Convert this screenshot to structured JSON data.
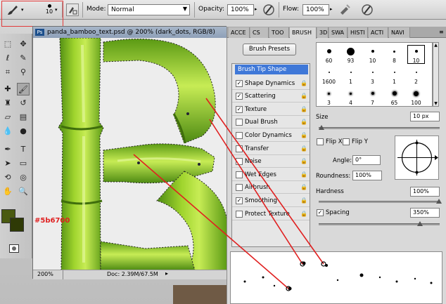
{
  "options_bar": {
    "brush_size": "10",
    "mode_label": "Mode:",
    "mode_value": "Normal",
    "opacity_label": "Opacity:",
    "opacity_value": "100%",
    "flow_label": "Flow:",
    "flow_value": "100%"
  },
  "document": {
    "title": "panda_bamboo_text.psd @ 200% (dark_dots, RGB/8)",
    "badge": "Ps",
    "zoom": "200%",
    "doc_size": "Doc: 2.39M/67.5M",
    "annotation_color_text": "#5b6700",
    "annotation_color": "#e02020",
    "foreground_color": "#4a5a10",
    "background_color": "#2f3a06"
  },
  "panel": {
    "tabs": [
      "ACCE",
      "CS",
      "TOO",
      "BRUSH",
      "3D",
      "SWA",
      "HISTI",
      "ACTI",
      "NAVI"
    ],
    "active_tab": "BRUSH",
    "brush_presets_label": "Brush Presets",
    "options": [
      {
        "label": "Brush Tip Shape",
        "checked": null,
        "header": true
      },
      {
        "label": "Shape Dynamics",
        "checked": true
      },
      {
        "label": "Scattering",
        "checked": true
      },
      {
        "label": "Texture",
        "checked": true
      },
      {
        "label": "Dual Brush",
        "checked": false
      },
      {
        "label": "Color Dynamics",
        "checked": false
      },
      {
        "label": "Transfer",
        "checked": false
      },
      {
        "label": "Noise",
        "checked": false
      },
      {
        "label": "Wet Edges",
        "checked": false
      },
      {
        "label": "Airbrush",
        "checked": false
      },
      {
        "label": "Smoothing",
        "checked": true
      },
      {
        "label": "Protect Texture",
        "checked": false
      }
    ],
    "tips": [
      {
        "size": "60",
        "dot": 6
      },
      {
        "size": "93",
        "dot": 11
      },
      {
        "size": "10",
        "dot": 4
      },
      {
        "size": "8",
        "dot": 3
      },
      {
        "size": "10",
        "dot": 4,
        "selected": true
      },
      {
        "size": "1600",
        "dot": 2
      },
      {
        "size": "1",
        "dot": 2
      },
      {
        "size": "3",
        "dot": 2
      },
      {
        "size": "1",
        "dot": 2
      },
      {
        "size": "2",
        "dot": 2
      },
      {
        "size": "3",
        "dot": 3
      },
      {
        "size": "4",
        "dot": 3
      },
      {
        "size": "7",
        "dot": 4
      },
      {
        "size": "65",
        "dot": 6
      },
      {
        "size": "100",
        "dot": 7
      }
    ],
    "size_label": "Size",
    "size_value": "10 px",
    "flip_x": "Flip X",
    "flip_y": "Flip Y",
    "angle_label": "Angle:",
    "angle_value": "0°",
    "roundness_label": "Roundness:",
    "roundness_value": "100%",
    "hardness_label": "Hardness",
    "hardness_value": "100%",
    "spacing_label": "Spacing",
    "spacing_value": "350%",
    "spacing_checked": true
  }
}
